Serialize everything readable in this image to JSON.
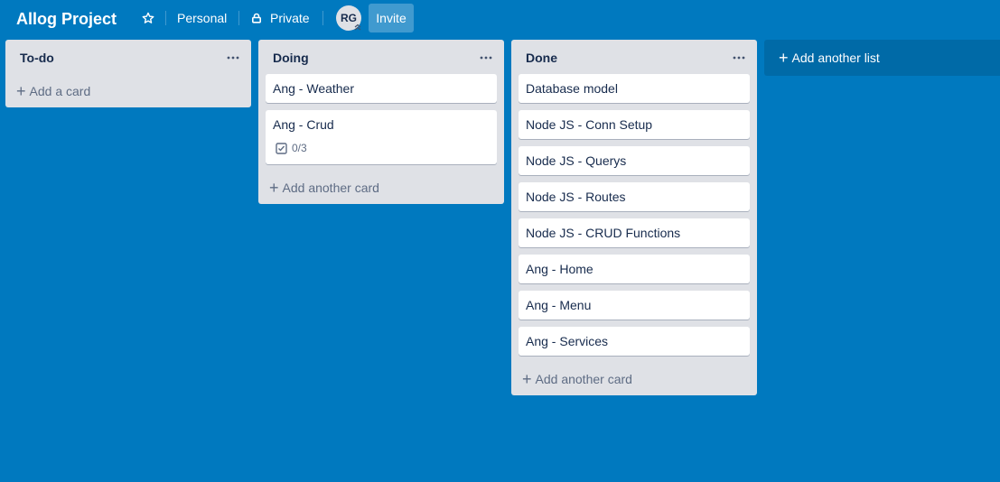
{
  "board": {
    "title": "Allog Project",
    "personal_label": "Personal",
    "private_label": "Private",
    "avatar_initials": "RG",
    "invite_label": "Invite"
  },
  "lists": [
    {
      "title": "To-do",
      "cards": [],
      "add_label": "Add a card"
    },
    {
      "title": "Doing",
      "cards": [
        {
          "title": "Ang - Weather"
        },
        {
          "title": "Ang - Crud",
          "checklist": "0/3"
        }
      ],
      "add_label": "Add another card"
    },
    {
      "title": "Done",
      "cards": [
        {
          "title": "Database model"
        },
        {
          "title": "Node JS - Conn Setup"
        },
        {
          "title": "Node JS - Querys"
        },
        {
          "title": "Node JS - Routes"
        },
        {
          "title": "Node JS - CRUD Functions"
        },
        {
          "title": "Ang - Home"
        },
        {
          "title": "Ang - Menu"
        },
        {
          "title": "Ang - Services"
        }
      ],
      "add_label": "Add another card"
    }
  ],
  "add_list_label": "Add another list",
  "colors": {
    "board_background": "#0079bf",
    "list_background": "#dfe1e6",
    "text": "#172b4d",
    "muted_text": "#5e6c84"
  },
  "icons": {
    "star": "star-icon",
    "lock": "lock-icon",
    "list_menu": "more-horizontal-icon",
    "plus": "plus-icon",
    "checklist": "checkbox-icon",
    "avatar_badge": "admin-chevrons-icon"
  }
}
